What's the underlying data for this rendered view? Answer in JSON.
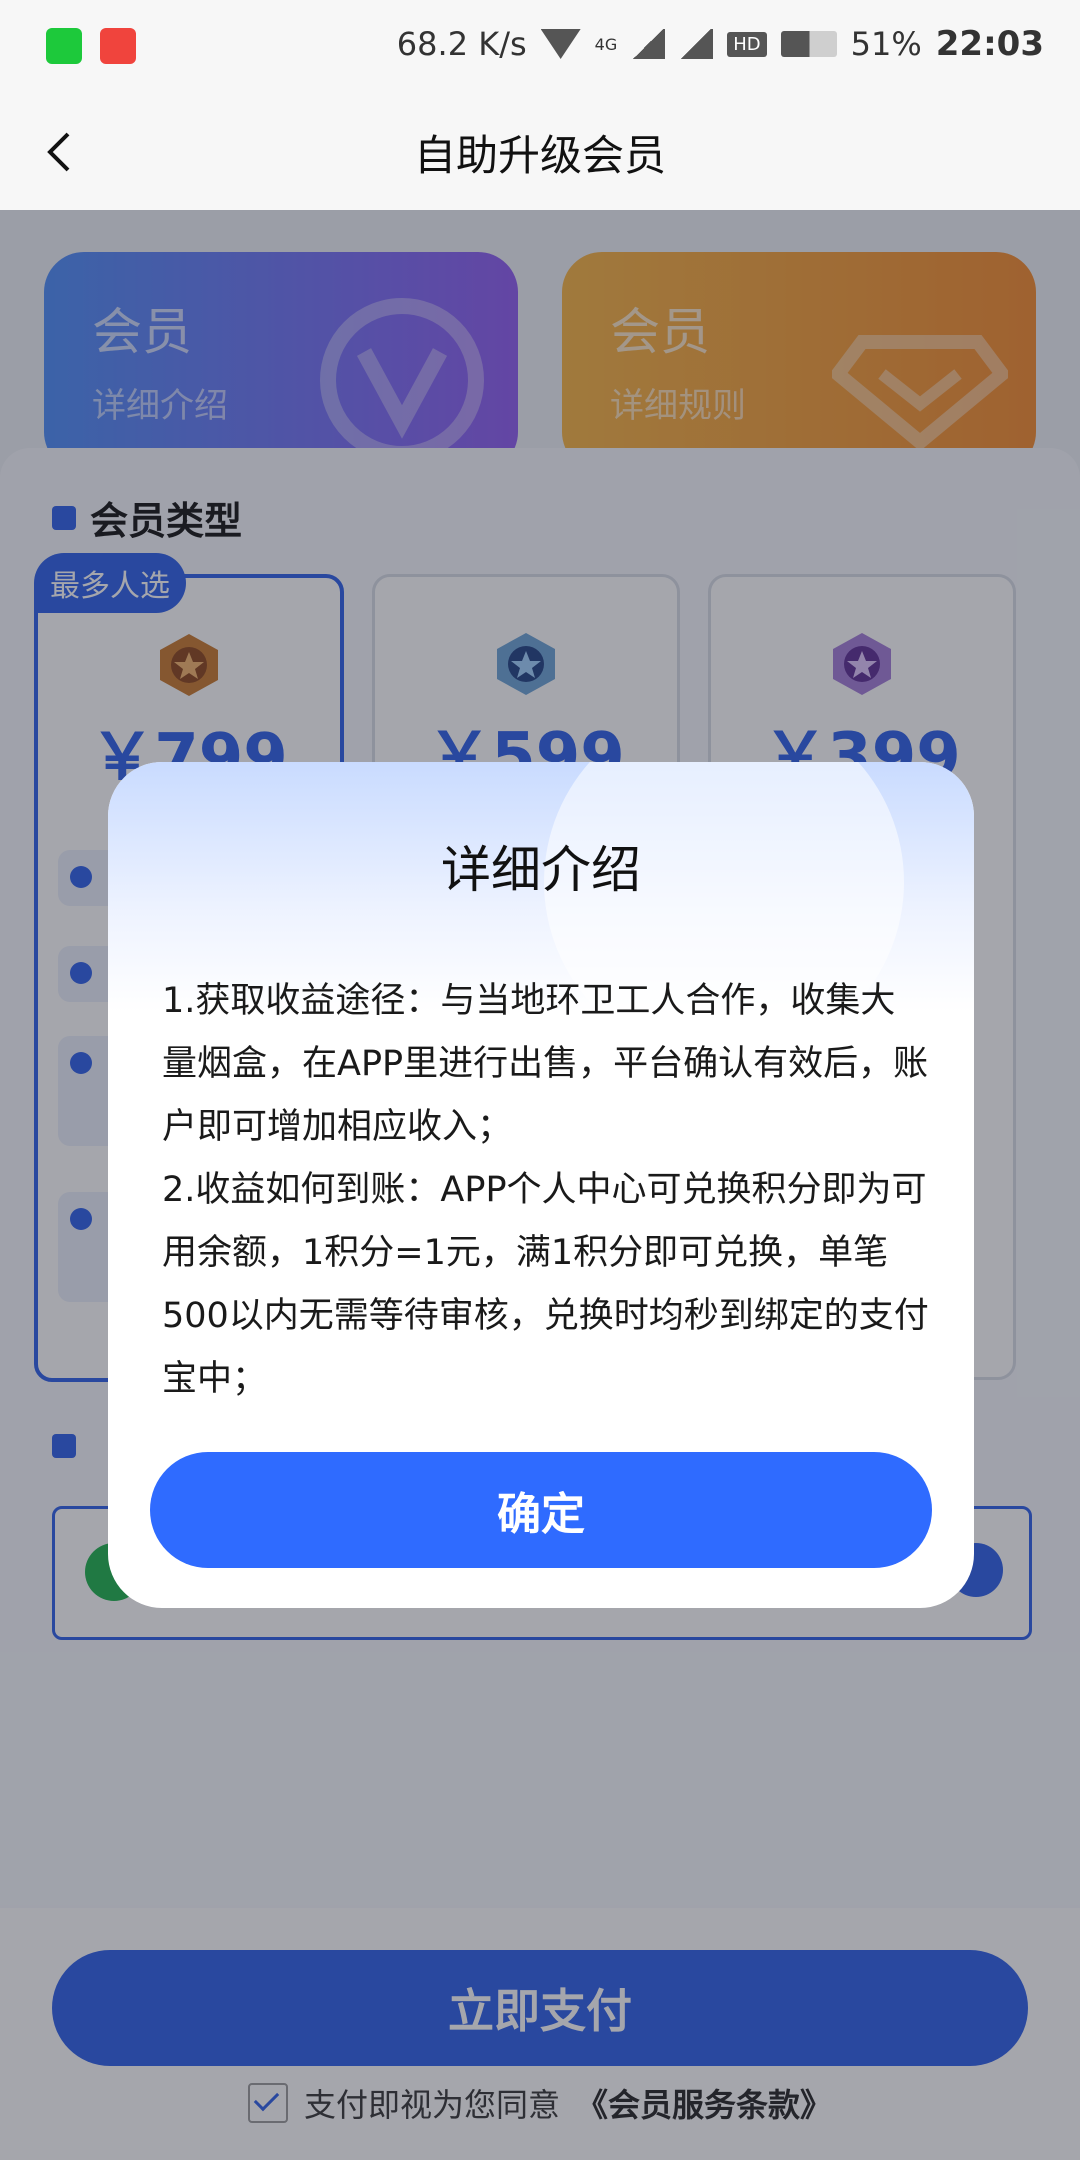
{
  "status_bar": {
    "net_speed": "68.2 K/s",
    "network_type": "4G",
    "hd_label": "HD",
    "battery": "51%",
    "time": "22:03"
  },
  "header": {
    "title": "自助升级会员"
  },
  "top_cards": [
    {
      "title": "会员",
      "subtitle": "详细介绍"
    },
    {
      "title": "会员",
      "subtitle": "详细规则"
    }
  ],
  "membership": {
    "section_title": "会员类型",
    "popular_tag": "最多人选",
    "plans": [
      {
        "price": "￥799",
        "selected": true
      },
      {
        "price": "￥599",
        "selected": false
      },
      {
        "price": "￥399",
        "selected": false
      }
    ]
  },
  "payment": {
    "pay_button": "立即支付",
    "agreement_prefix": "支付即视为您同意",
    "agreement_link": "《会员服务条款》"
  },
  "modal": {
    "title": "详细介绍",
    "paragraphs": [
      "1.获取收益途径：与当地环卫工人合作，收集大量烟盒，在APP里进行出售，平台确认有效后，账户即可增加相应收入；",
      "2.收益如何到账：APP个人中心可兑换积分即为可用余额，1积分=1元，满1积分即可兑换，单笔500以内无需等待审核，兑换时均秒到绑定的支付宝中；"
    ],
    "confirm_button": "确定"
  },
  "colors": {
    "accent": "#2a5de8",
    "modal_button": "#2f6bff"
  }
}
